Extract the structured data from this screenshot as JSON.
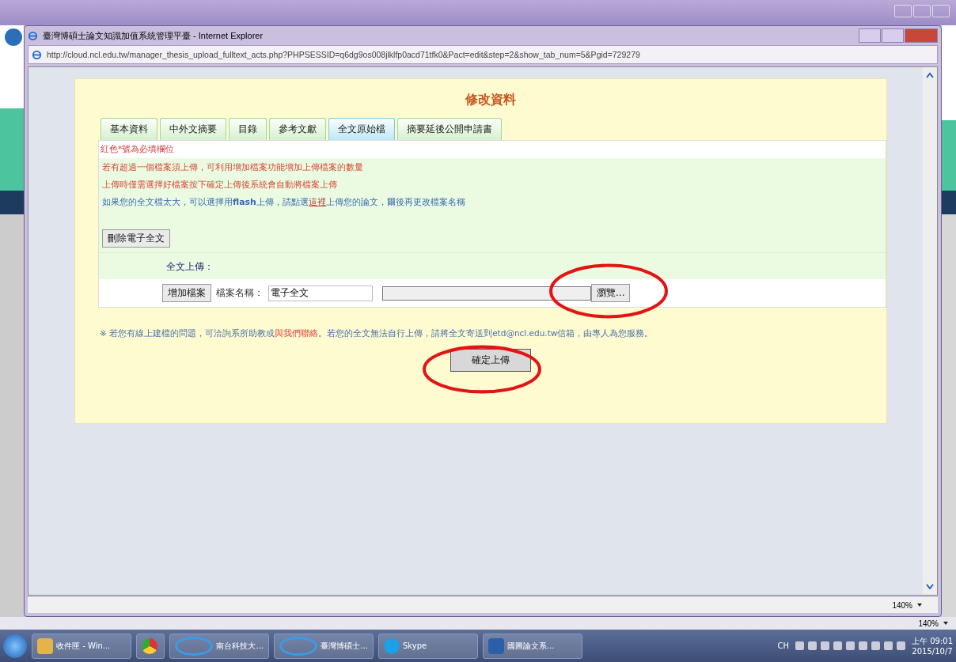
{
  "browser": {
    "title": "臺灣博碩士論文知識加值系統管理平臺 - Internet Explorer",
    "url": "http://cloud.ncl.edu.tw/manager_thesis_upload_fulltext_acts.php?PHPSESSID=q6dg9os008jlklfp0acd71tfk0&Pact=edit&step=2&show_tab_num=5&Pgid=729279",
    "zoom": "140%"
  },
  "outer_zoom": "140%",
  "page": {
    "heading": "修改資料",
    "tabs": [
      {
        "label": "基本資料",
        "selected": false
      },
      {
        "label": "中外文摘要",
        "selected": false
      },
      {
        "label": "目錄",
        "selected": false
      },
      {
        "label": "參考文獻",
        "selected": false
      },
      {
        "label": "全文原始檔",
        "selected": true
      },
      {
        "label": "摘要延後公開申請書",
        "selected": false
      }
    ],
    "required_note": "紅色*號為必填欄位",
    "notes": [
      {
        "kind": "warning",
        "text": "若有超過一個檔案須上傳，可利用增加檔案功能增加上傳檔案的數量"
      },
      {
        "kind": "warning",
        "text": "上傳時僅需選擇好檔案按下確定上傳後系統會自動將檔案上傳"
      },
      {
        "kind": "info",
        "text": "如果您的全文檔太大，可以選擇用**flash**上傳，請點選",
        "link": "這裡",
        "after": "上傳您的論文，爾後再更改檔案名稱"
      }
    ],
    "delete_button": "刪除電子全文",
    "upload_label": "全文上傳：",
    "add_file_button": "增加檔案",
    "file_name_label": "檔案名稱：",
    "file_name_value": "電子全文",
    "browse_button": "瀏覽...",
    "footer": {
      "before": "※ 若您有線上建檔的問題，可洽詢系所助教或",
      "link": "與我們聯絡",
      "after": "。若您的全文無法自行上傳，請將全文寄送到etd@ncl.edu.tw信箱，由專人為您服務。"
    },
    "submit_button": "確定上傳"
  },
  "taskbar": {
    "items": [
      {
        "kind": "mail",
        "label": "收件匣 - Win..."
      },
      {
        "kind": "chrome"
      },
      {
        "kind": "ie",
        "label": "南台科技大..."
      },
      {
        "kind": "ie",
        "label": "臺灣博碩士..."
      },
      {
        "kind": "skype",
        "label": "Skype"
      },
      {
        "kind": "word",
        "label": "國圖論文系..."
      }
    ],
    "language": "CH",
    "time": "上午 09:01",
    "date": "2015/10/7"
  }
}
